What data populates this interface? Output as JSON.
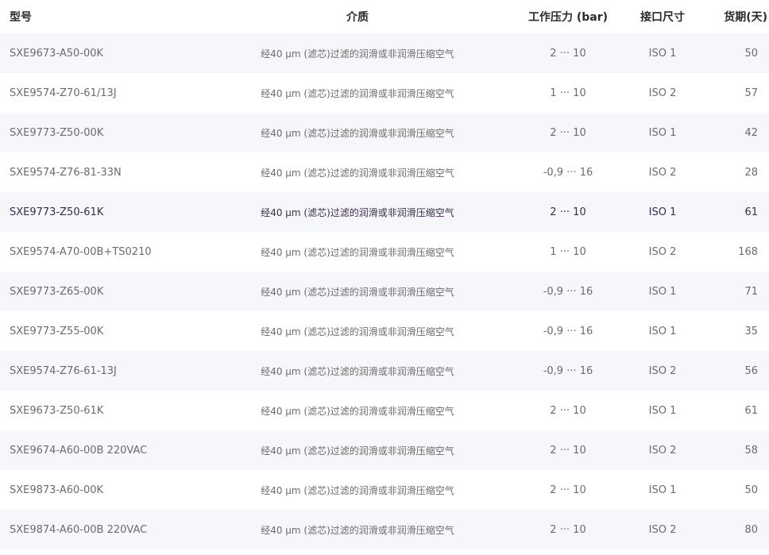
{
  "table": {
    "headers": {
      "model": "型号",
      "medium": "介质",
      "pressure": "工作压力 (bar)",
      "port": "接口尺寸",
      "days": "货期(天)"
    },
    "rows": [
      {
        "model": "SXE9673-A50-00K",
        "medium": "经40 μm (滤芯)过滤的润滑或非润滑压缩空气",
        "pressure": "2 ··· 10",
        "port": "ISO 1",
        "days": "50"
      },
      {
        "model": "SXE9574-Z70-61/13J",
        "medium": "经40 μm (滤芯)过滤的润滑或非润滑压缩空气",
        "pressure": "1 ··· 10",
        "port": "ISO 2",
        "days": "57"
      },
      {
        "model": "SXE9773-Z50-00K",
        "medium": "经40 μm (滤芯)过滤的润滑或非润滑压缩空气",
        "pressure": "2 ··· 10",
        "port": "ISO 1",
        "days": "42"
      },
      {
        "model": "SXE9574-Z76-81-33N",
        "medium": "经40 μm (滤芯)过滤的润滑或非润滑压缩空气",
        "pressure": "-0,9 ··· 16",
        "port": "ISO 2",
        "days": "28"
      },
      {
        "model": "SXE9773-Z50-61K",
        "medium": "经40 μm (滤芯)过滤的润滑或非润滑压缩空气",
        "pressure": "2 ··· 10",
        "port": "ISO 1",
        "days": "61"
      },
      {
        "model": "SXE9574-A70-00B+TS0210",
        "medium": "经40 μm (滤芯)过滤的润滑或非润滑压缩空气",
        "pressure": "1 ··· 10",
        "port": "ISO 2",
        "days": "168"
      },
      {
        "model": "SXE9773-Z65-00K",
        "medium": "经40 μm (滤芯)过滤的润滑或非润滑压缩空气",
        "pressure": "-0,9 ··· 16",
        "port": "ISO 1",
        "days": "71"
      },
      {
        "model": "SXE9773-Z55-00K",
        "medium": "经40 μm (滤芯)过滤的润滑或非润滑压缩空气",
        "pressure": "-0,9 ··· 16",
        "port": "ISO 1",
        "days": "35"
      },
      {
        "model": "SXE9574-Z76-61-13J",
        "medium": "经40 μm (滤芯)过滤的润滑或非润滑压缩空气",
        "pressure": "-0,9 ··· 16",
        "port": "ISO 2",
        "days": "56"
      },
      {
        "model": "SXE9673-Z50-61K",
        "medium": "经40 μm (滤芯)过滤的润滑或非润滑压缩空气",
        "pressure": "2 ··· 10",
        "port": "ISO 1",
        "days": "61"
      },
      {
        "model": "SXE9674-A60-00B 220VAC",
        "medium": "经40 μm (滤芯)过滤的润滑或非润滑压缩空气",
        "pressure": "2 ··· 10",
        "port": "ISO 2",
        "days": "58"
      },
      {
        "model": "SXE9873-A60-00K",
        "medium": "经40 μm (滤芯)过滤的润滑或非润滑压缩空气",
        "pressure": "2 ··· 10",
        "port": "ISO 1",
        "days": "50"
      },
      {
        "model": "SXE9874-A60-00B 220VAC",
        "medium": "经40 μm (滤芯)过滤的润滑或非润滑压缩空气",
        "pressure": "2 ··· 10",
        "port": "ISO 2",
        "days": "80"
      }
    ]
  }
}
